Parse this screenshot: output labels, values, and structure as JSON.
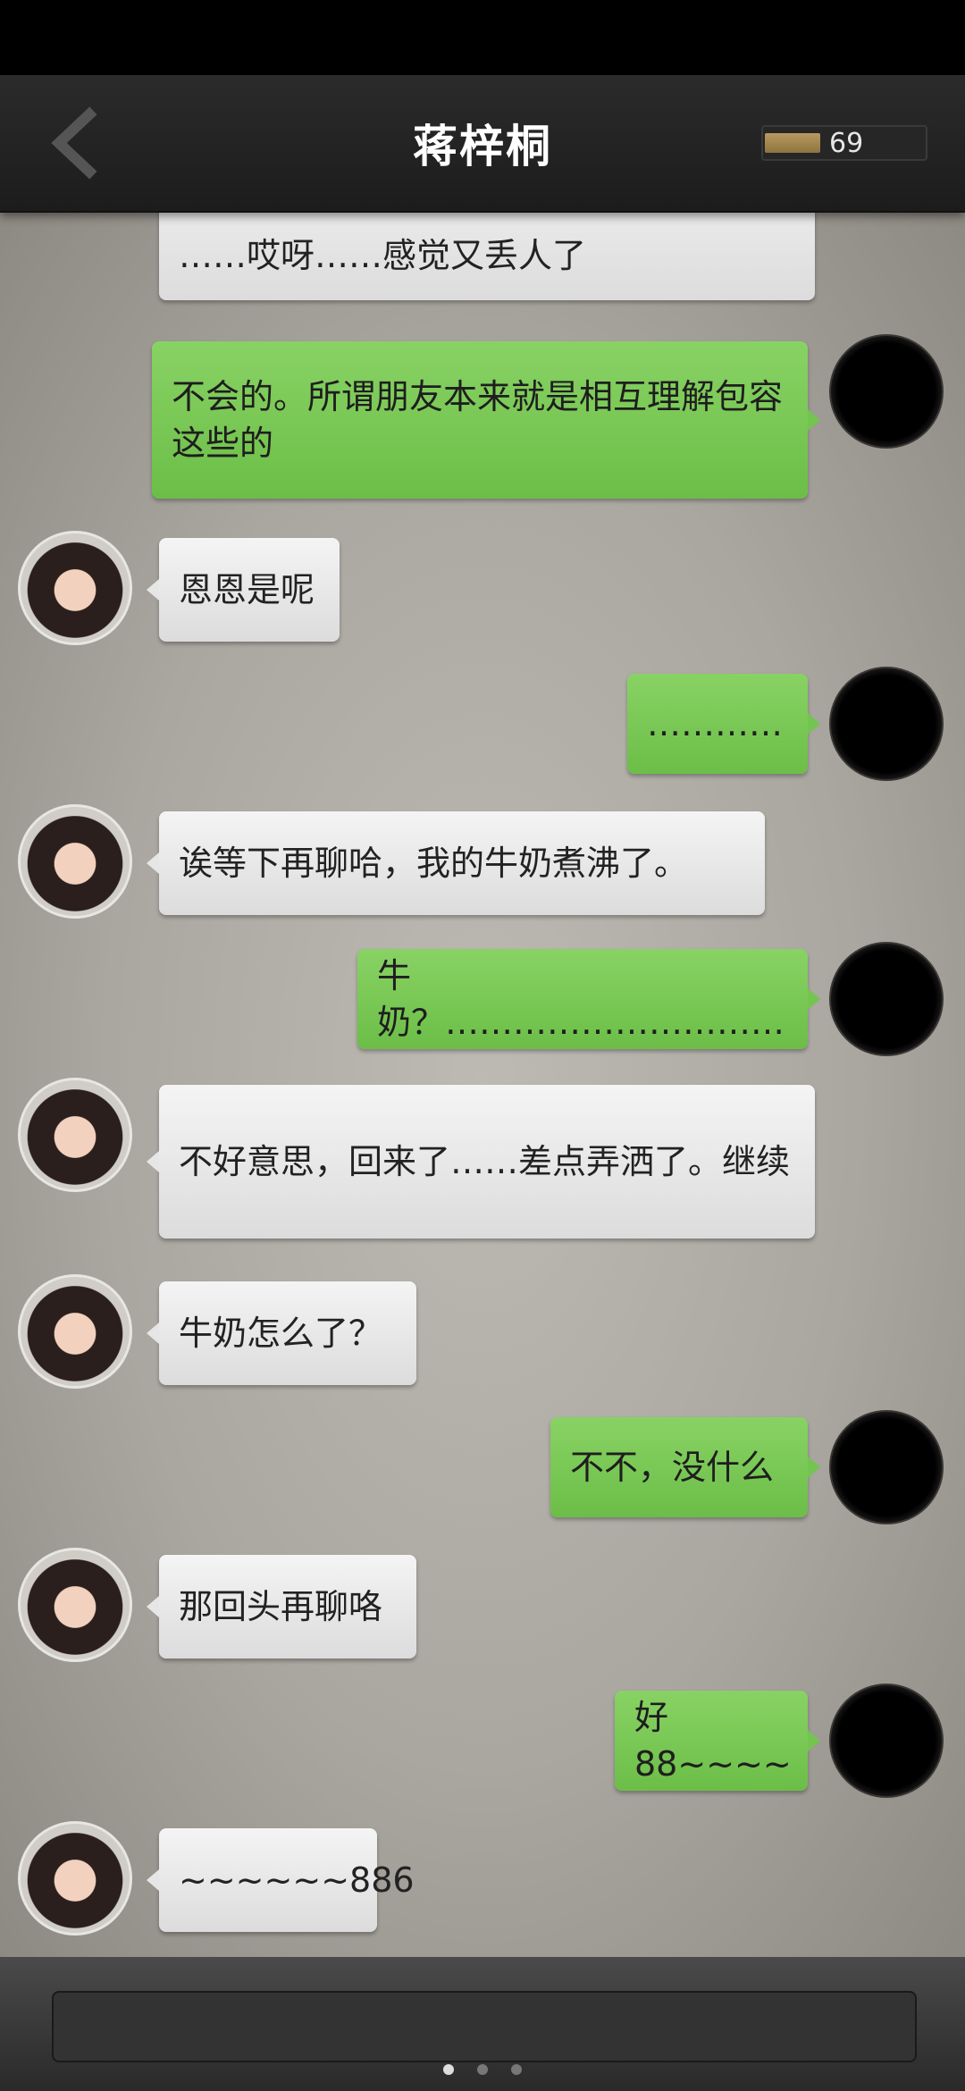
{
  "header": {
    "title": "蒋梓桐",
    "coin_count": "69",
    "icons": {
      "back": "chevron-left-icon",
      "coin": "coin-bar-icon"
    }
  },
  "messages": [
    {
      "from": "her",
      "text": "……哎呀……感觉又丢人了"
    },
    {
      "from": "me",
      "text": "不会的。所谓朋友本来就是相互理解包容这些的"
    },
    {
      "from": "her",
      "text": "恩恩是呢"
    },
    {
      "from": "me",
      "text": "…………"
    },
    {
      "from": "her",
      "text": "诶等下再聊哈，我的牛奶煮沸了。"
    },
    {
      "from": "me",
      "text": "牛奶？…………………………"
    },
    {
      "from": "her",
      "text": "不好意思，回来了……差点弄洒了。继续"
    },
    {
      "from": "her",
      "text": "牛奶怎么了？"
    },
    {
      "from": "me",
      "text": "不不，没什么"
    },
    {
      "from": "her",
      "text": "那回头再聊咯"
    },
    {
      "from": "me",
      "text": "好88~~~~"
    },
    {
      "from": "her",
      "text": "~~~~~~886"
    }
  ],
  "footer": {
    "page_indicator": {
      "current": 1,
      "total": 3
    }
  },
  "colors": {
    "incoming_bubble": "#e8e8e8",
    "outgoing_bubble": "#7ac858",
    "header": "#222222"
  }
}
